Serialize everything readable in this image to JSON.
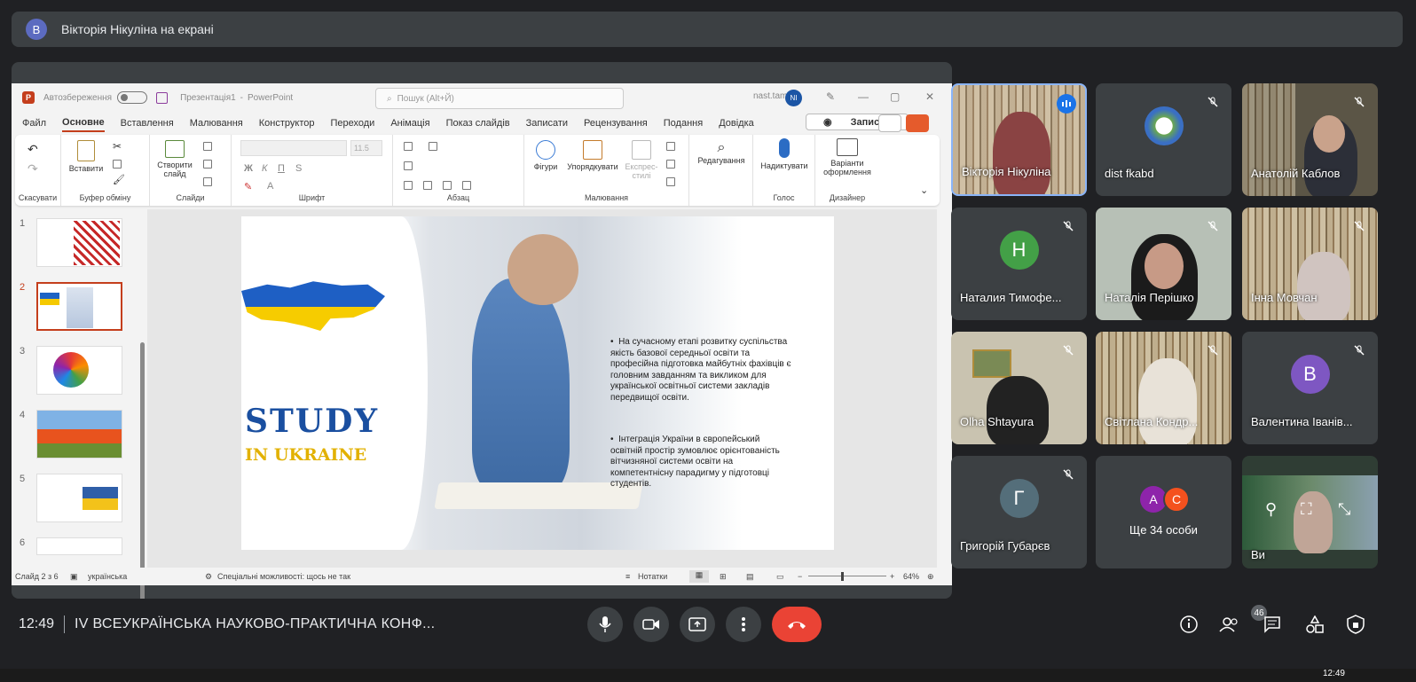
{
  "banner": {
    "avatar_letter": "В",
    "text": "Вікторія Нікуліна на екрані"
  },
  "ppt": {
    "title": {
      "autosave": "Автозбереження",
      "doc_name": "Презентація1",
      "sep": "-",
      "app": "PowerPoint",
      "search_placeholder": "Пошук (Alt+Й)",
      "user": "nast.tam",
      "initials": "NI"
    },
    "menu": [
      "Файл",
      "Основне",
      "Вставлення",
      "Малювання",
      "Конструктор",
      "Переходи",
      "Анімація",
      "Показ слайдів",
      "Записати",
      "Рецензування",
      "Подання",
      "Довідка"
    ],
    "record_button": "Записати",
    "ribbon": {
      "undo_label": "Скасувати",
      "paste": "Вставити",
      "clipboard": "Буфер обміну",
      "create_slide": "Створити",
      "create_slide2": "слайд",
      "slides": "Слайди",
      "font": "Шрифт",
      "font_size": "11.5",
      "paragraph": "Абзац",
      "shapes": "Фігури",
      "arrange": "Упорядкувати",
      "express1": "Експрес-",
      "express2": "стилі",
      "drawing": "Малювання",
      "editing": "Редагування",
      "dictate": "Надиктувати",
      "voice": "Голос",
      "design_ideas1": "Варіанти",
      "design_ideas2": "оформлення",
      "designer": "Дизайнер"
    },
    "thumbnails": [
      "1",
      "2",
      "3",
      "4",
      "5",
      "6"
    ],
    "slide": {
      "study": "STUDY",
      "in_ukraine": "IN UKRAINE",
      "bullet1": "На сучасному етапі розвитку суспільства якість базової середньої освіти та професійна підготовка майбутніх фахівців є головним завданням та викликом для української освітньої системи закладів передвищої освіти.",
      "bullet2": "Інтеграція України в європейський освітній простір зумовлює орієнтованість вітчизняної системи освіти на компетентнісну парадигму у підготовці студентів."
    },
    "status": {
      "slide_of": "Слайд 2 з 6",
      "language": "українська",
      "accessibility": "Спеціальні можливості: щось не так",
      "notes": "Нотатки",
      "zoom": "64%"
    }
  },
  "participants": [
    {
      "name": "Вікторія Нікуліна"
    },
    {
      "name": "dist fkabd"
    },
    {
      "name": "Анатолій Каблов"
    },
    {
      "name": "Наталия Тимофе...",
      "letter": "Н"
    },
    {
      "name": "Наталія Перішко"
    },
    {
      "name": "Інна Мовчан"
    },
    {
      "name": "Olha Shtayura"
    },
    {
      "name": "Світлана Кондр..."
    },
    {
      "name": "Валентина Іванів...",
      "letter": "В"
    },
    {
      "name": "Григорій Губарєв",
      "letter": "Г"
    },
    {
      "name": "Ще 34 особи",
      "letters": [
        "А",
        "С"
      ]
    },
    {
      "name": "Ви"
    }
  ],
  "colors": {
    "avatar_n": "#43a047",
    "avatar_v": "#7e57c2",
    "avatar_g": "#546e7a",
    "avatar_a": "#8e24aa",
    "avatar_c": "#f4511e",
    "end_call": "#ea4335",
    "accent_ppt": "#c43e1c"
  },
  "bottom": {
    "time": "12:49",
    "meeting": "IV ВСЕУКРАЇНСЬКА НАУКОВО-ПРАКТИЧНА КОНФ...",
    "people_count": "46"
  },
  "taskbar": {
    "time": "12:49"
  }
}
